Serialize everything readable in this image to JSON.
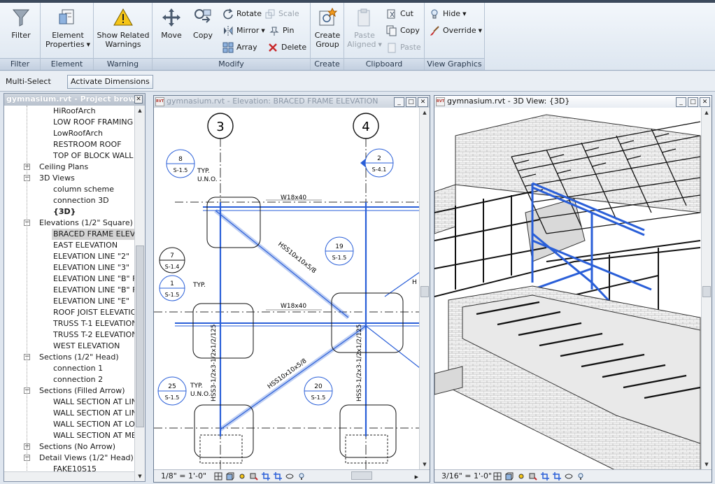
{
  "ribbon": {
    "filter": {
      "label": "Filter",
      "panel": "Filter"
    },
    "element": {
      "label1": "Element",
      "label2": "Properties",
      "panel": "Element"
    },
    "warning": {
      "label1": "Show Related",
      "label2": "Warnings",
      "panel": "Warning"
    },
    "modify": {
      "panel": "Modify",
      "move": "Move",
      "copy": "Copy",
      "rotate": "Rotate",
      "scale": "Scale",
      "mirror": "Mirror",
      "pin": "Pin",
      "array": "Array",
      "delete": "Delete"
    },
    "create": {
      "label1": "Create",
      "label2": "Group",
      "panel": "Create"
    },
    "clipboard": {
      "panel": "Clipboard",
      "paste1": "Paste",
      "paste2": "Aligned",
      "cut": "Cut",
      "copy": "Copy",
      "paste": "Paste"
    },
    "view_graphics": {
      "panel": "View Graphics",
      "hide": "Hide",
      "override": "Override"
    }
  },
  "options_bar": {
    "multi_select": "Multi-Select",
    "activate_dimensions": "Activate Dimensions"
  },
  "browser": {
    "title": "gymnasium.rvt - Project brows",
    "items": [
      {
        "label": "HiRoofArch",
        "level": 2
      },
      {
        "label": "LOW ROOF FRAMING",
        "level": 2
      },
      {
        "label": "LowRoofArch",
        "level": 2
      },
      {
        "label": "RESTROOM ROOF",
        "level": 2
      },
      {
        "label": "TOP OF BLOCK WALL",
        "level": 2
      },
      {
        "label": "Ceiling Plans",
        "level": 1,
        "exp": "+"
      },
      {
        "label": "3D Views",
        "level": 1,
        "exp": "−"
      },
      {
        "label": "column scheme",
        "level": 2
      },
      {
        "label": "connection 3D",
        "level": 2
      },
      {
        "label": "{3D}",
        "level": 2,
        "bold": true
      },
      {
        "label": "Elevations (1/2\" Square)",
        "level": 1,
        "exp": "−"
      },
      {
        "label": "BRACED FRAME ELEVA",
        "level": 2,
        "selected": true
      },
      {
        "label": "EAST ELEVATION",
        "level": 2
      },
      {
        "label": "ELEVATION LINE \"2\"",
        "level": 2
      },
      {
        "label": "ELEVATION LINE \"3\"",
        "level": 2
      },
      {
        "label": "ELEVATION LINE \"B\" F",
        "level": 2
      },
      {
        "label": "ELEVATION LINE \"B\" F",
        "level": 2
      },
      {
        "label": "ELEVATION LINE \"E\"",
        "level": 2
      },
      {
        "label": "ROOF JOIST ELEVATIO",
        "level": 2
      },
      {
        "label": "TRUSS T-1 ELEVATION",
        "level": 2
      },
      {
        "label": "TRUSS T-2 ELEVATION",
        "level": 2
      },
      {
        "label": "WEST ELEVATION",
        "level": 2
      },
      {
        "label": "Sections (1/2\" Head)",
        "level": 1,
        "exp": "−"
      },
      {
        "label": "connection 1",
        "level": 2
      },
      {
        "label": "connection 2",
        "level": 2
      },
      {
        "label": "Sections (Filled Arrow)",
        "level": 1,
        "exp": "−"
      },
      {
        "label": "WALL SECTION AT LIN",
        "level": 2
      },
      {
        "label": "WALL SECTION AT LIN",
        "level": 2
      },
      {
        "label": "WALL SECTION AT LOV",
        "level": 2
      },
      {
        "label": "WALL SECTION AT ME",
        "level": 2
      },
      {
        "label": "Sections (No Arrow)",
        "level": 1,
        "exp": "+"
      },
      {
        "label": "Detail Views (1/2\" Head)",
        "level": 1,
        "exp": "−"
      },
      {
        "label": "FAKE10S15",
        "level": 2
      }
    ]
  },
  "elevation_view": {
    "title": "gymnasium.rvt - Elevation: BRACED FRAME ELEVATION",
    "scale": "1/8\" = 1'-0\"",
    "grid_3": "3",
    "grid_4": "4",
    "beam_top": "W18x40",
    "beam_mid": "W18x40",
    "brace1": "HSS10x10x5/8",
    "brace2": "HSS10x10x5/8",
    "column1": "HSS3-1/2x3-1/2x1/2/125",
    "column2": "HSS3-1/2x3-1/2x1/2/125",
    "typ": "TYP.",
    "uno": "U.N.O.",
    "callouts": [
      {
        "num": "8",
        "sheet": "S-1.5"
      },
      {
        "num": "7",
        "sheet": "S-1.4"
      },
      {
        "num": "1",
        "sheet": "S-1.5"
      },
      {
        "num": "19",
        "sheet": "S-1.5"
      },
      {
        "num": "25",
        "sheet": "S-1.5"
      },
      {
        "num": "20",
        "sheet": "S-1.5"
      },
      {
        "num": "2",
        "sheet": "S-4.1"
      }
    ],
    "partial_label": "H"
  },
  "view3d": {
    "title": "gymnasium.rvt - 3D View: {3D}",
    "scale": "3/16\" = 1'-0\""
  },
  "window_buttons": {
    "minimize": "_",
    "restore": "□",
    "close": "✕"
  },
  "colors": {
    "accent": "#2a5fd8",
    "ribbon_bg": "#e4ebf3"
  }
}
